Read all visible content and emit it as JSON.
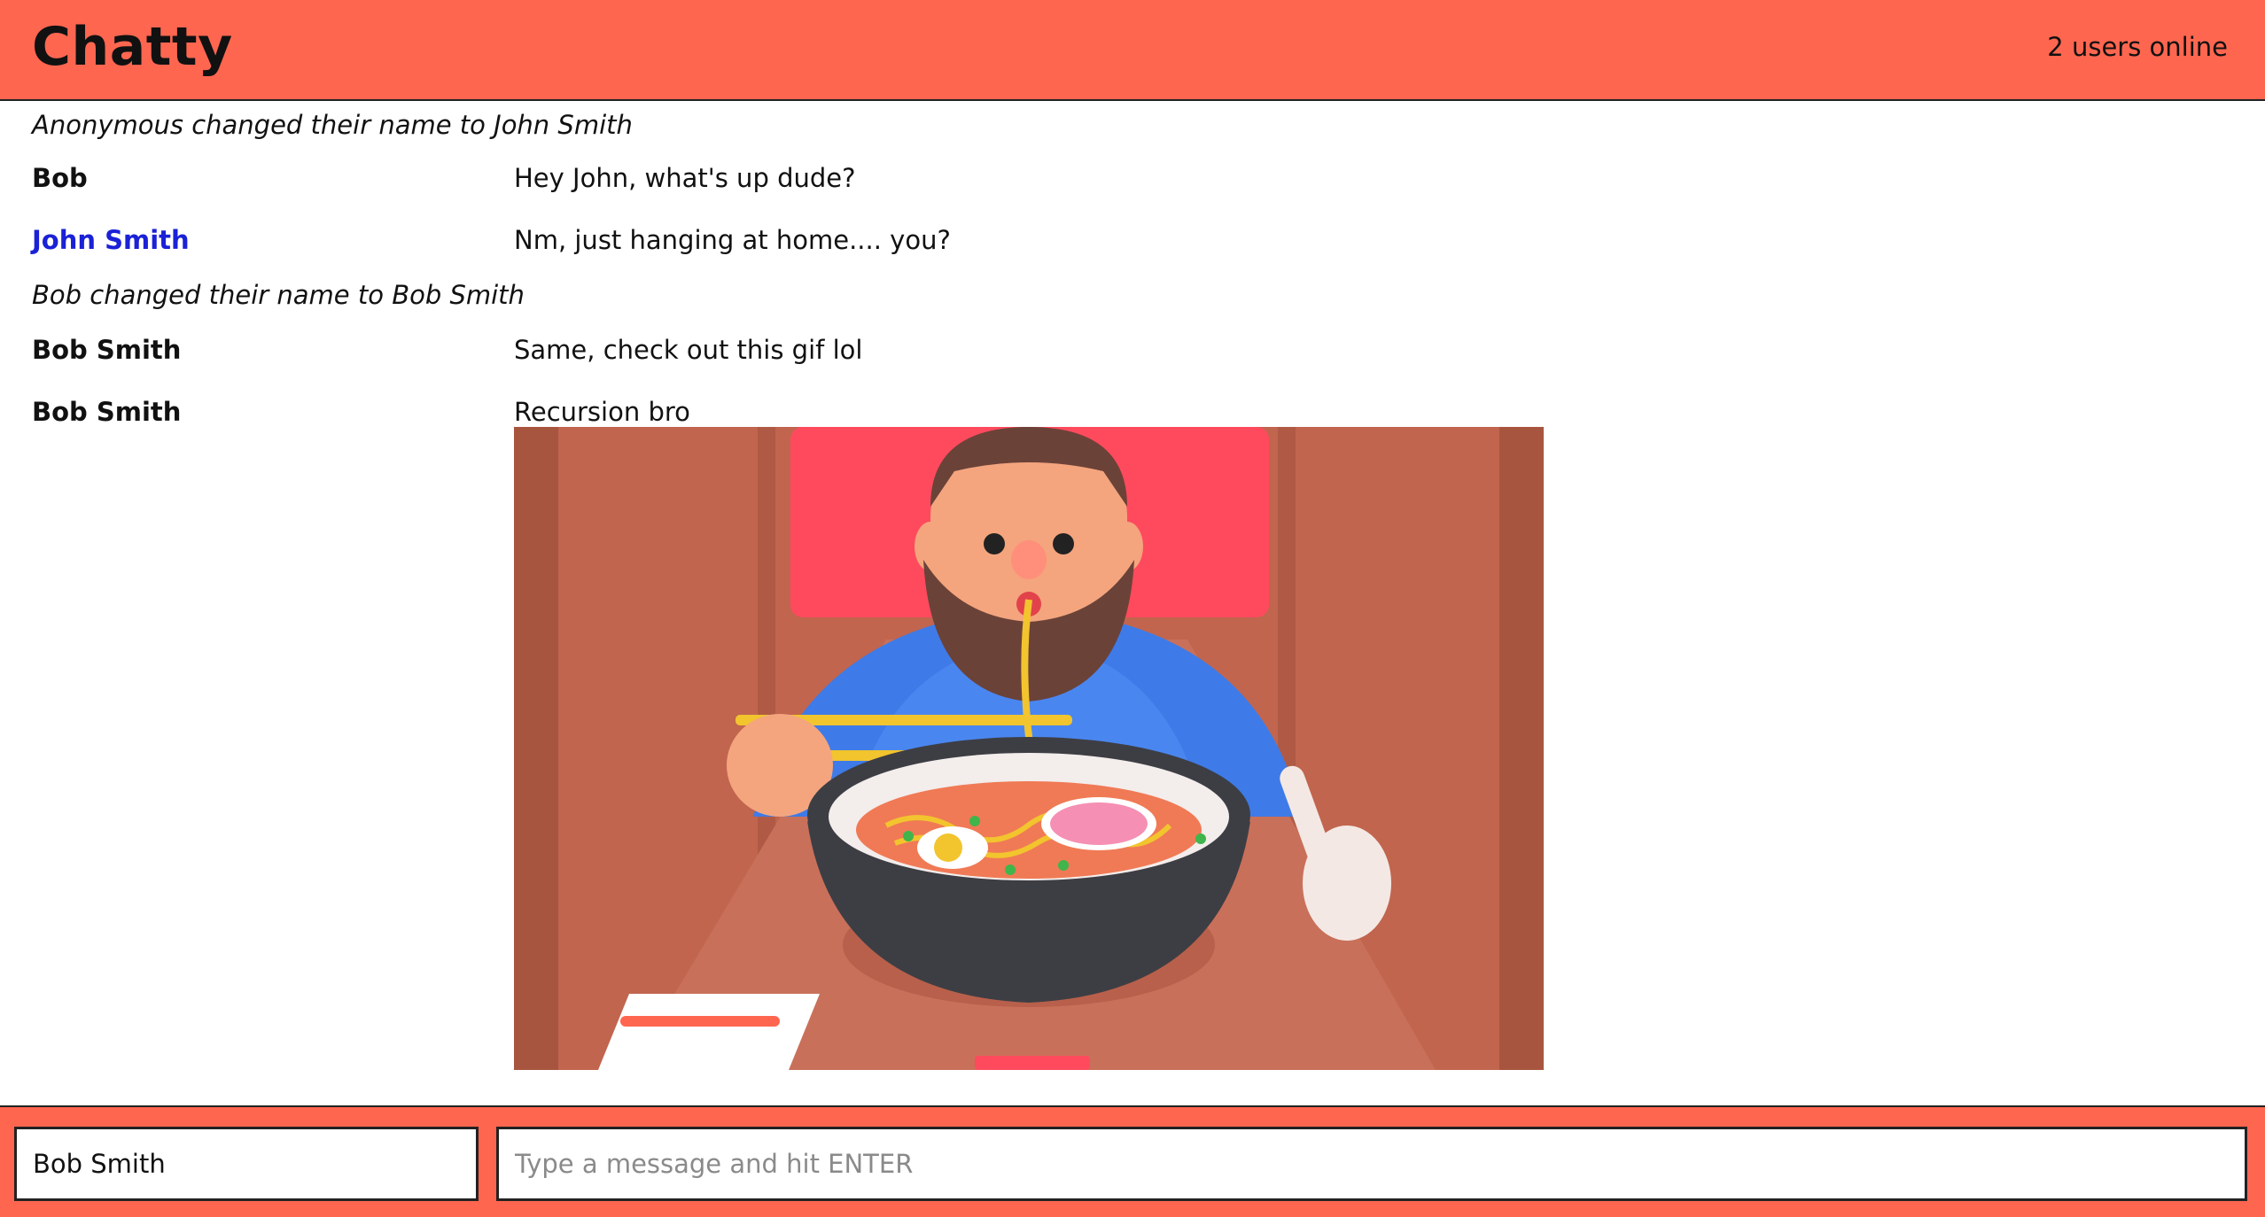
{
  "navbar": {
    "brand": "Chatty",
    "online_count": "2 users online",
    "color": "#FF6650"
  },
  "messages": [
    {
      "type": "system",
      "text": "Anonymous changed their name to John Smith"
    },
    {
      "type": "message",
      "username": "Bob",
      "content": "Hey John, what's up dude?"
    },
    {
      "type": "message",
      "username": "John Smith",
      "content": "Nm, just hanging at home.... you?",
      "username_color": "#1a21d6"
    },
    {
      "type": "system",
      "text": "Bob changed their name to Bob Smith"
    },
    {
      "type": "message",
      "username": "Bob Smith",
      "content": "Same, check out this gif lol"
    },
    {
      "type": "message",
      "username": "Bob Smith",
      "content": "Recursion bro",
      "attachment": "bearded-man-eating-ramen-gif"
    }
  ],
  "chatbar": {
    "username_value": "Bob Smith",
    "message_placeholder": "Type a message and hit ENTER"
  }
}
